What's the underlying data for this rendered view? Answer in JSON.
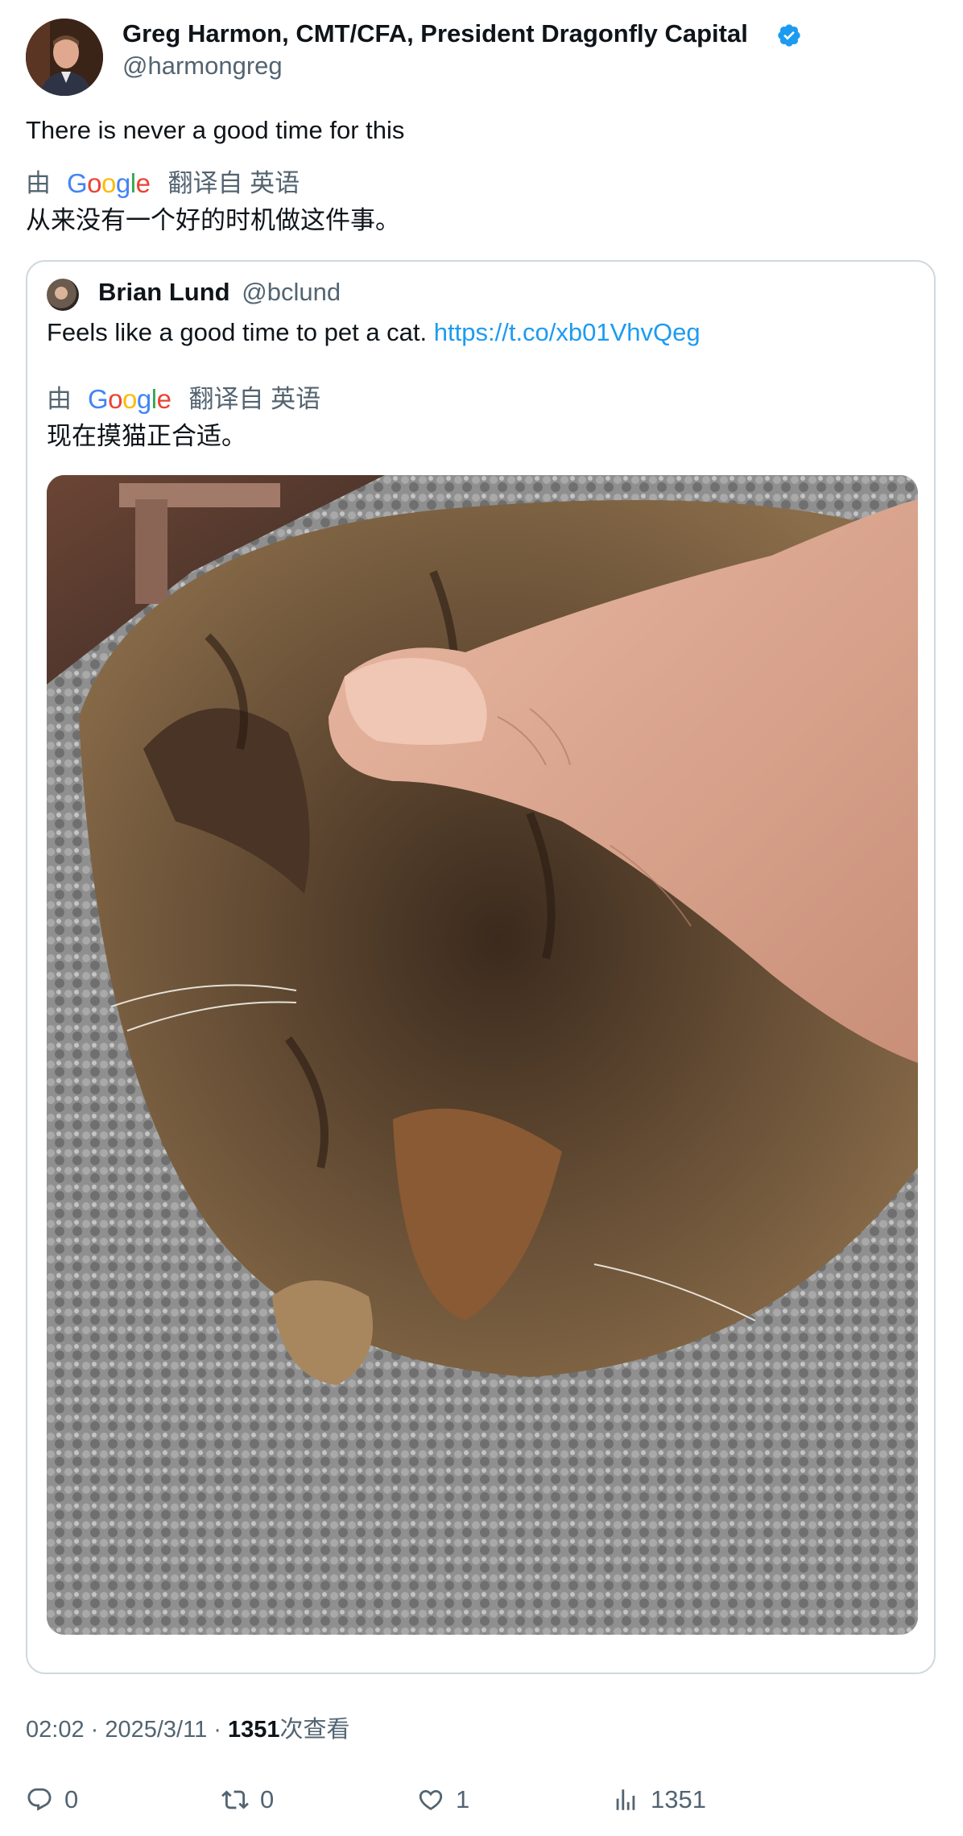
{
  "author": {
    "name": "Greg Harmon, CMT/CFA, President Dragonfly Capital",
    "handle": "@harmongreg",
    "verified_icon": "verified-badge-icon"
  },
  "tweet": {
    "text": "There is never a good time for this",
    "translate_by": "由",
    "translate_from": "翻译自 英语",
    "translated_text": "从来没有一个好的时机做这件事。"
  },
  "quote": {
    "name": "Brian Lund",
    "handle": "@bclund",
    "text": "Feels like a good time to pet a cat.",
    "link": "https://t.co/xb01VhvQeg",
    "translate_by": "由",
    "translate_from": "翻译自 英语",
    "translated_text": "现在摸猫正合适。"
  },
  "meta": {
    "time": "02:02 · 2025/3/11 · ",
    "views_count": "1351",
    "views_label": "次查看"
  },
  "actions": {
    "replies": "0",
    "retweets": "0",
    "likes": "1",
    "views": "1351"
  },
  "colors": {
    "link": "#1d9bf0",
    "secondary_text": "#536471",
    "border": "#cfd9de"
  }
}
